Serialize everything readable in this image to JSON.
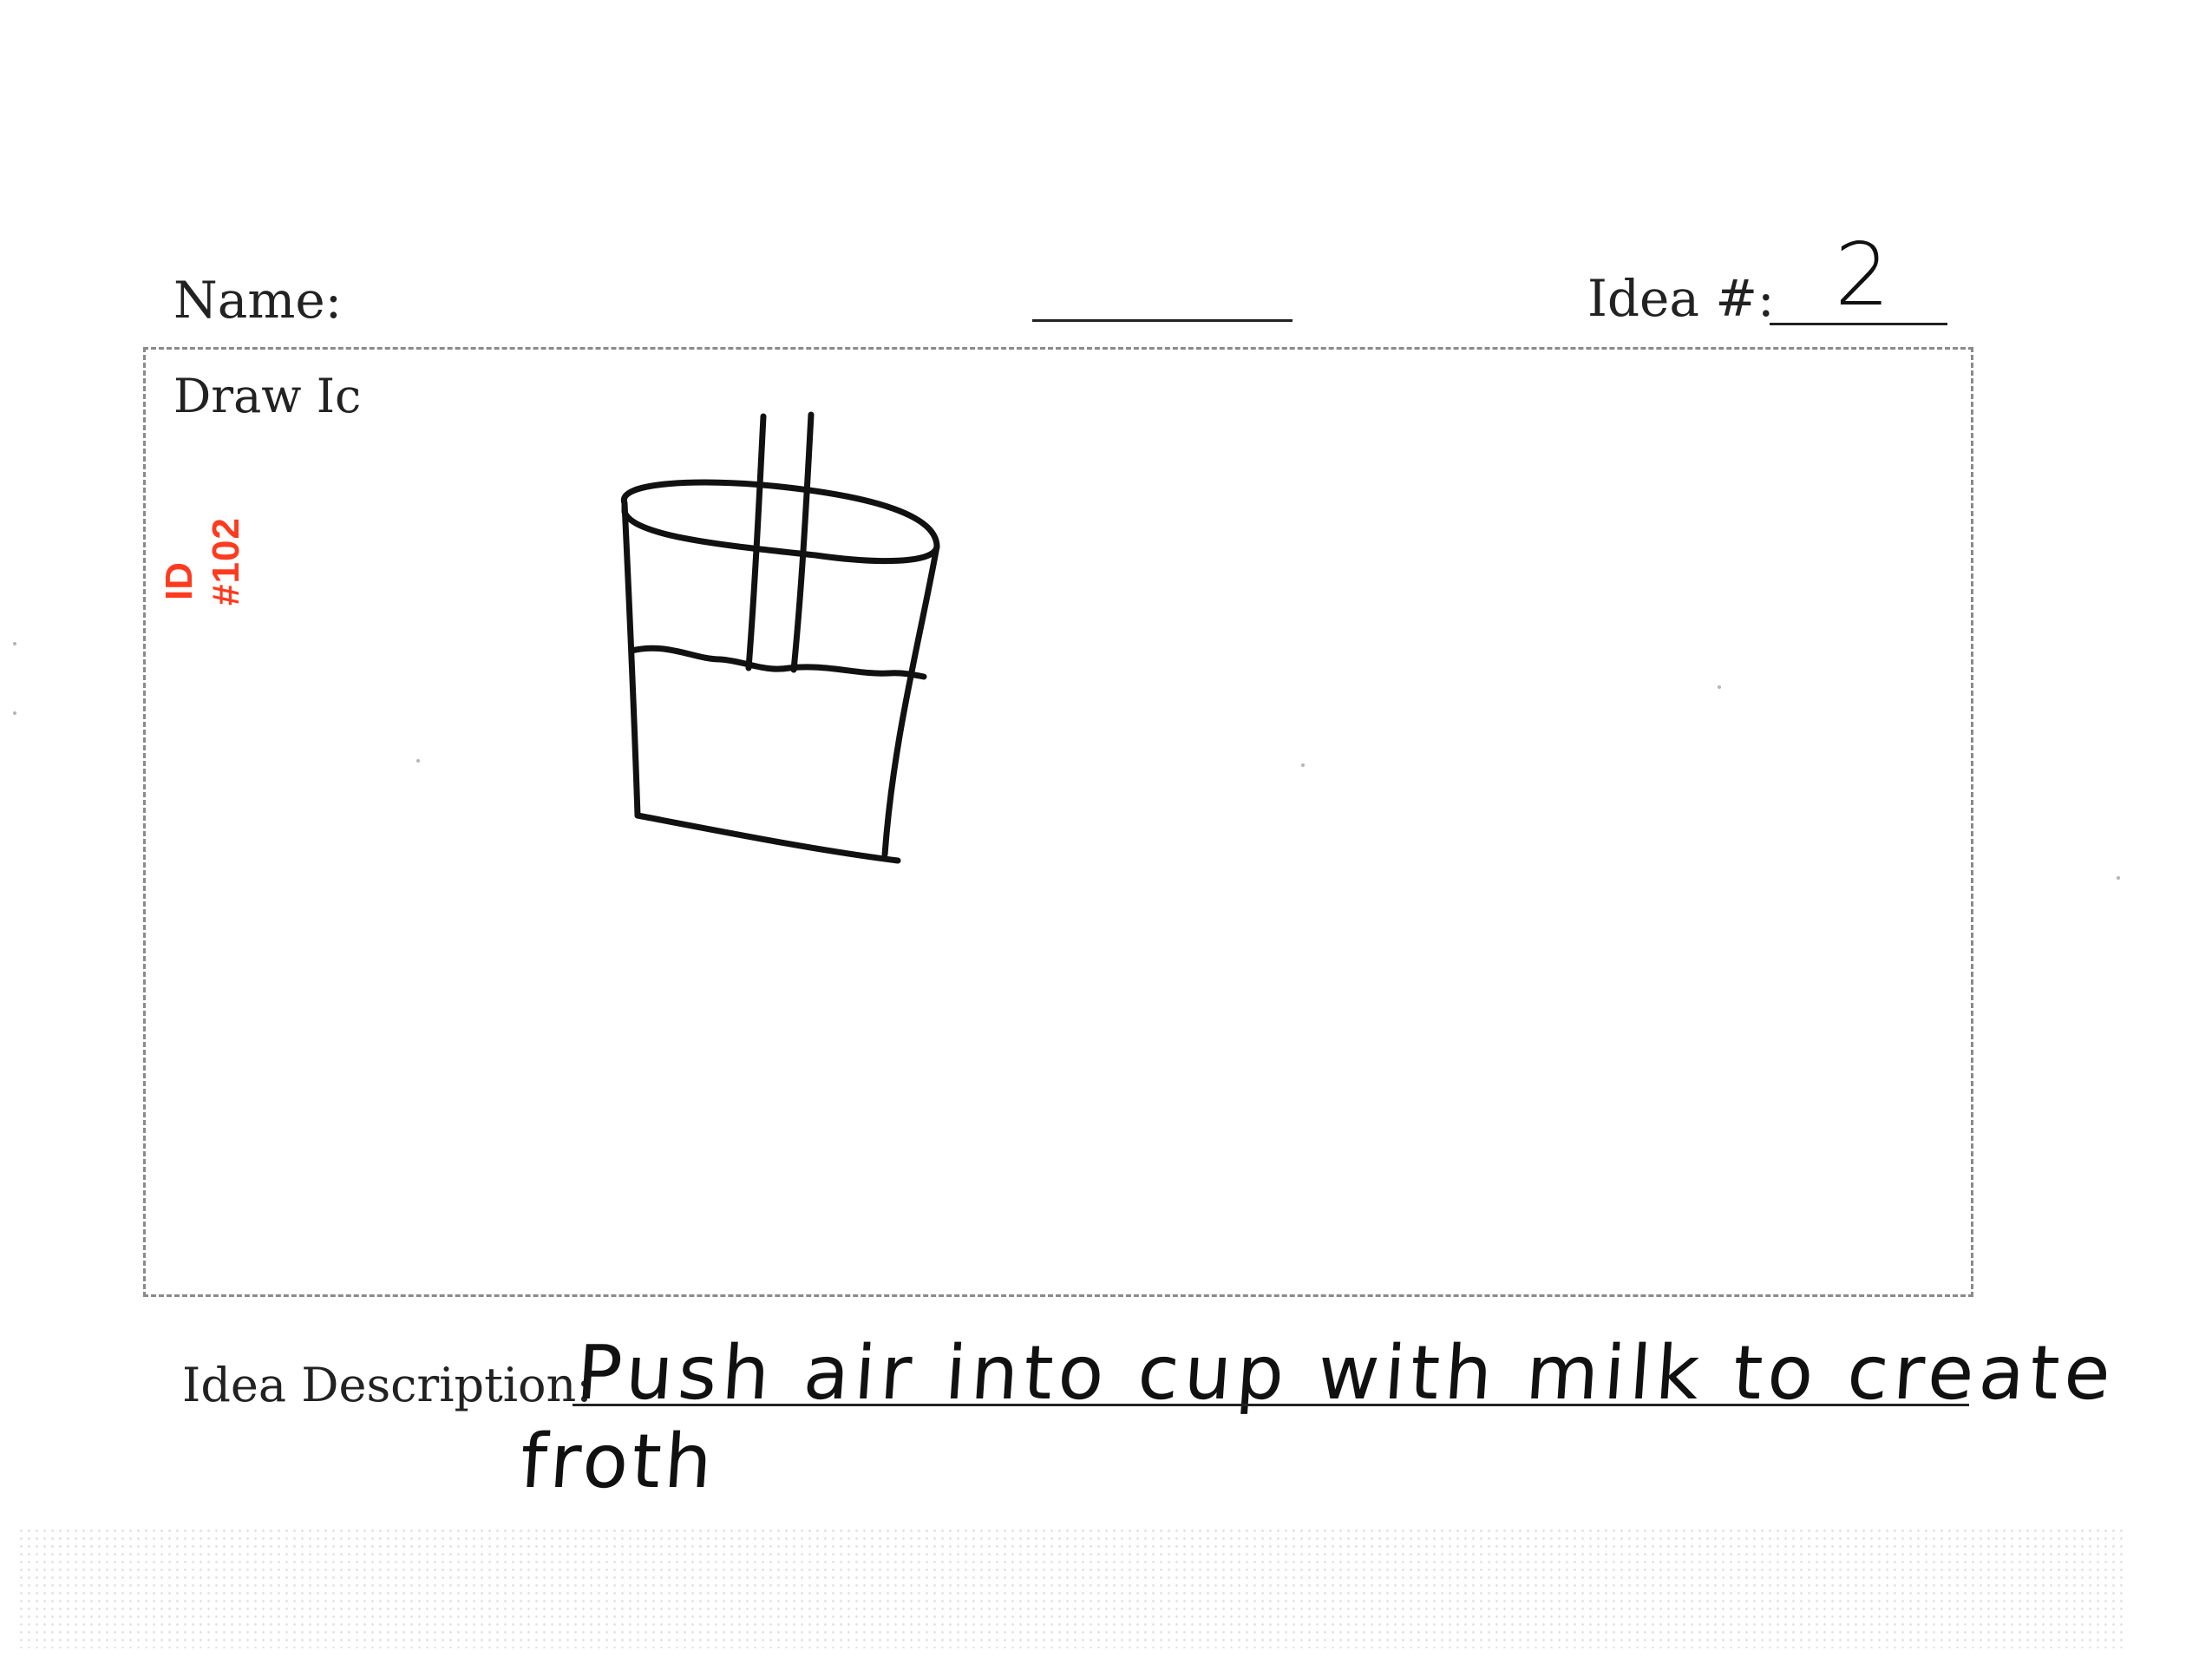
{
  "form": {
    "name_label": "Name:",
    "idea_number_label": "Idea #:",
    "idea_number_value": "2",
    "draw_label": "Draw Ic",
    "description_label": "Idea Description:",
    "description_line1": "Push air into cup with milk to create",
    "description_line2": "froth"
  },
  "stamp": {
    "label": "ID",
    "number": "#102",
    "color": "#ff3b1f"
  },
  "sketch": {
    "subject": "cup-with-straw-icon",
    "ink_color": "#111111"
  }
}
